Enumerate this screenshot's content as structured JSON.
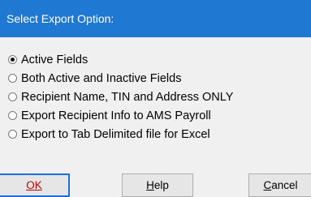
{
  "dialog": {
    "title": "Select Export Option:"
  },
  "options": [
    {
      "label": "Active Fields",
      "selected": true
    },
    {
      "label": "Both Active and Inactive Fields",
      "selected": false
    },
    {
      "label": "Recipient Name, TIN and Address ONLY",
      "selected": false
    },
    {
      "label": "Export Recipient Info to AMS Payroll",
      "selected": false
    },
    {
      "label": "Export to Tab Delimited file for Excel",
      "selected": false
    }
  ],
  "buttons": {
    "ok_first": "O",
    "ok_rest": "K",
    "help_first": "H",
    "help_rest": "elp",
    "cancel_first": "C",
    "cancel_rest": "ancel"
  },
  "colors": {
    "title_bar": "#1f78d1",
    "ok_text": "#c00000",
    "ok_border": "#1b6fd6"
  }
}
